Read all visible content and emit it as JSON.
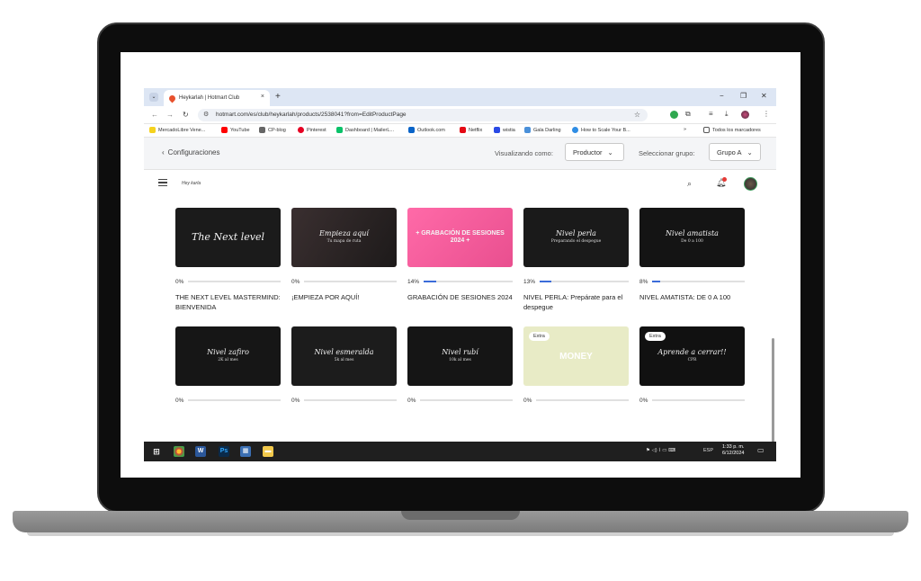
{
  "browser": {
    "tab_title": "Heykarlah | Hotmart Club",
    "tab_close": "×",
    "new_tab": "+",
    "url": "hotmart.com/es/club/heykarlah/products/2538041?from=EditProductPage",
    "window_minimize": "−",
    "window_restore": "❐",
    "window_close": "✕",
    "bookmarks": [
      {
        "label": "MercadoLibre Vene...",
        "color": "#f5d21e"
      },
      {
        "label": "YouTube",
        "color": "#ff0000"
      },
      {
        "label": "CP-blog",
        "color": "#666666"
      },
      {
        "label": "Pinterest",
        "color": "#e60023"
      },
      {
        "label": "Dashboard | MailerL...",
        "color": "#09c269"
      },
      {
        "label": "Outlook.com",
        "color": "#0a64c8"
      },
      {
        "label": "Netflix",
        "color": "#e50914"
      },
      {
        "label": "wistia",
        "color": "#2949e5"
      },
      {
        "label": "Gala Darling",
        "color": "#4a90d9"
      },
      {
        "label": "How to Scale Your B...",
        "color": "#2f8de4"
      }
    ],
    "bookmarks_overflow": "»",
    "all_bookmarks": "Todos los marcadores"
  },
  "config_bar": {
    "back_label": "Configuraciones",
    "viewing_as_label": "Visualizando como:",
    "viewing_as_value": "Productor",
    "group_label": "Seleccionar grupo:",
    "group_value": "Grupo A"
  },
  "app": {
    "logo_text": "Hey karla"
  },
  "courses_row1": [
    {
      "thumb_title": "The Next level",
      "thumb_sub": "",
      "bg": "#1b1b1b",
      "progress": "0%",
      "progress_value": 0,
      "title": "THE NEXT LEVEL MASTERMIND: BIENVENIDA"
    },
    {
      "thumb_title": "Empieza aquí",
      "thumb_sub": "Tu mapa de ruta",
      "bg": "#2a2324",
      "progress": "0%",
      "progress_value": 0,
      "title": "¡EMPIEZA POR AQUÍ!"
    },
    {
      "thumb_title": "+ GRABACIÓN DE SESIONES 2024 +",
      "thumb_sub": "",
      "bg": "#ee5a9a",
      "progress": "14%",
      "progress_value": 14,
      "title": "GRABACIÓN DE SESIONES 2024"
    },
    {
      "thumb_title": "Nivel perla",
      "thumb_sub": "Preparando el despegue",
      "bg": "#1a1a1a",
      "progress": "13%",
      "progress_value": 13,
      "title": "NIVEL PERLA: Prepárate para el despegue"
    },
    {
      "thumb_title": "Nivel amatista",
      "thumb_sub": "De 0 a 100",
      "bg": "#141414",
      "progress": "8%",
      "progress_value": 8,
      "title": "NIVEL AMATISTA: DE 0 A 100"
    }
  ],
  "courses_row2": [
    {
      "thumb_title": "Nivel zafiro",
      "thumb_sub": "2K al mes",
      "bg": "#161616",
      "progress": "0%",
      "progress_value": 0,
      "extra": ""
    },
    {
      "thumb_title": "Nivel esmeralda",
      "thumb_sub": "5k al mes",
      "bg": "#1c1c1c",
      "progress": "0%",
      "progress_value": 0,
      "extra": ""
    },
    {
      "thumb_title": "Nivel rubí",
      "thumb_sub": "10k al mes",
      "bg": "#151515",
      "progress": "0%",
      "progress_value": 0,
      "extra": ""
    },
    {
      "thumb_title": "MONEY",
      "thumb_sub": "",
      "bg": "#e8ebc6",
      "progress": "0%",
      "progress_value": 0,
      "extra": "Extra"
    },
    {
      "thumb_title": "Aprende a cerrar!!",
      "thumb_sub": "CPR",
      "bg": "#111111",
      "progress": "0%",
      "progress_value": 0,
      "extra": "Extra"
    }
  ],
  "taskbar": {
    "lang": "ESP",
    "time": "1:33 p. m.",
    "date": "6/12/2024"
  }
}
